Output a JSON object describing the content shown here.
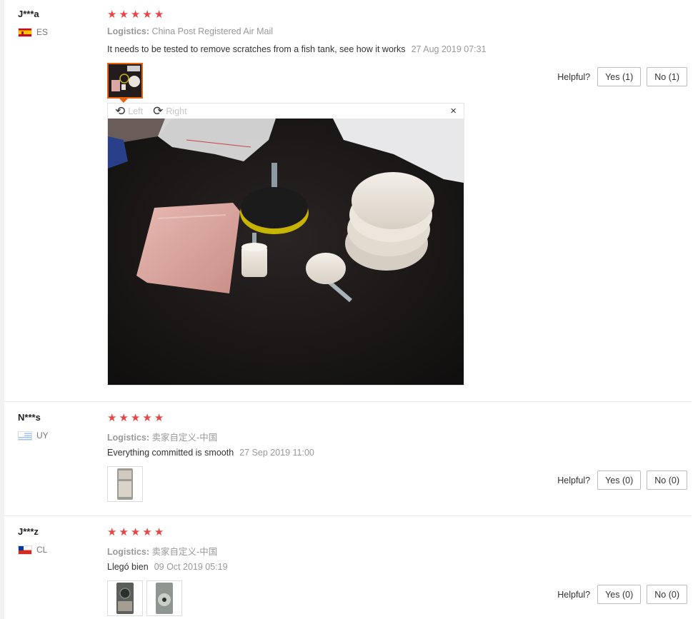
{
  "reviews": [
    {
      "user": "J***a",
      "country": "ES",
      "stars": 5,
      "logistics_label": "Logistics:",
      "logistics_value": "China Post Registered Air Mail",
      "text": "It needs to be tested to remove scratches from a fish tank, see how it works",
      "date": "27 Aug 2019 07:31",
      "helpful": "Helpful?",
      "yes": "Yes (1)",
      "no": "No (1)"
    },
    {
      "user": "N***s",
      "country": "UY",
      "stars": 5,
      "logistics_label": "Logistics:",
      "logistics_value": "卖家自定义-中国",
      "text": "Everything committed is smooth",
      "date": "27 Sep 2019 11:00",
      "helpful": "Helpful?",
      "yes": "Yes (0)",
      "no": "No (0)"
    },
    {
      "user": "J***z",
      "country": "CL",
      "stars": 5,
      "logistics_label": "Logistics:",
      "logistics_value": "卖家自定义-中国",
      "text": "Llegó bien",
      "date": "09 Oct 2019 05:19",
      "helpful": "Helpful?",
      "yes": "Yes (0)",
      "no": "No (0)"
    }
  ],
  "viewer": {
    "rotate_left": "Left",
    "rotate_right": "Right",
    "close": "×"
  },
  "icons": {
    "star": "★",
    "rotate_left": "⟲",
    "rotate_right": "⟳"
  },
  "colors": {
    "star": "#e84545",
    "active_thumb": "#e9620a",
    "muted_text": "#999999"
  }
}
